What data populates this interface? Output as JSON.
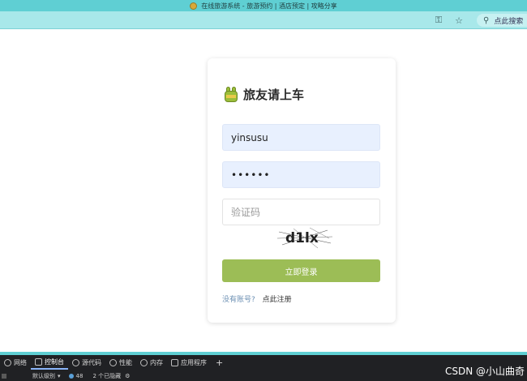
{
  "window": {
    "title": "在线旅游系统 - 旅游预约 | 酒店预定 | 攻略分享"
  },
  "toolbar": {
    "key_icon": "key-icon",
    "bookmark_icon": "star-icon",
    "search_icon": "search-icon",
    "search_placeholder": "点此搜索"
  },
  "login": {
    "brand": "旅友请上车",
    "username_value": "yinsusu",
    "password_value": "••••••",
    "captcha_placeholder": "验证码",
    "captcha_text": "d1lx",
    "submit_label": "立即登录",
    "no_account_text": "没有账号?",
    "register_link": "点此注册",
    "colors": {
      "button": "#9cbd56",
      "input_filled": "#e8f0fe"
    }
  },
  "devtools": {
    "tabs": [
      {
        "label": "网络",
        "icon": "wifi-icon"
      },
      {
        "label": "控制台",
        "icon": "console-icon"
      },
      {
        "label": "源代码",
        "icon": "bug-icon"
      },
      {
        "label": "性能",
        "icon": "gauge-icon"
      },
      {
        "label": "内存",
        "icon": "memory-icon"
      },
      {
        "label": "应用程序",
        "icon": "window-icon"
      }
    ],
    "add_label": "+",
    "level_label": "默认级别",
    "message_count": "48",
    "hidden_text": "2 个已隐藏",
    "gear_icon": "gear-icon"
  },
  "watermark": "CSDN @小山曲奇"
}
